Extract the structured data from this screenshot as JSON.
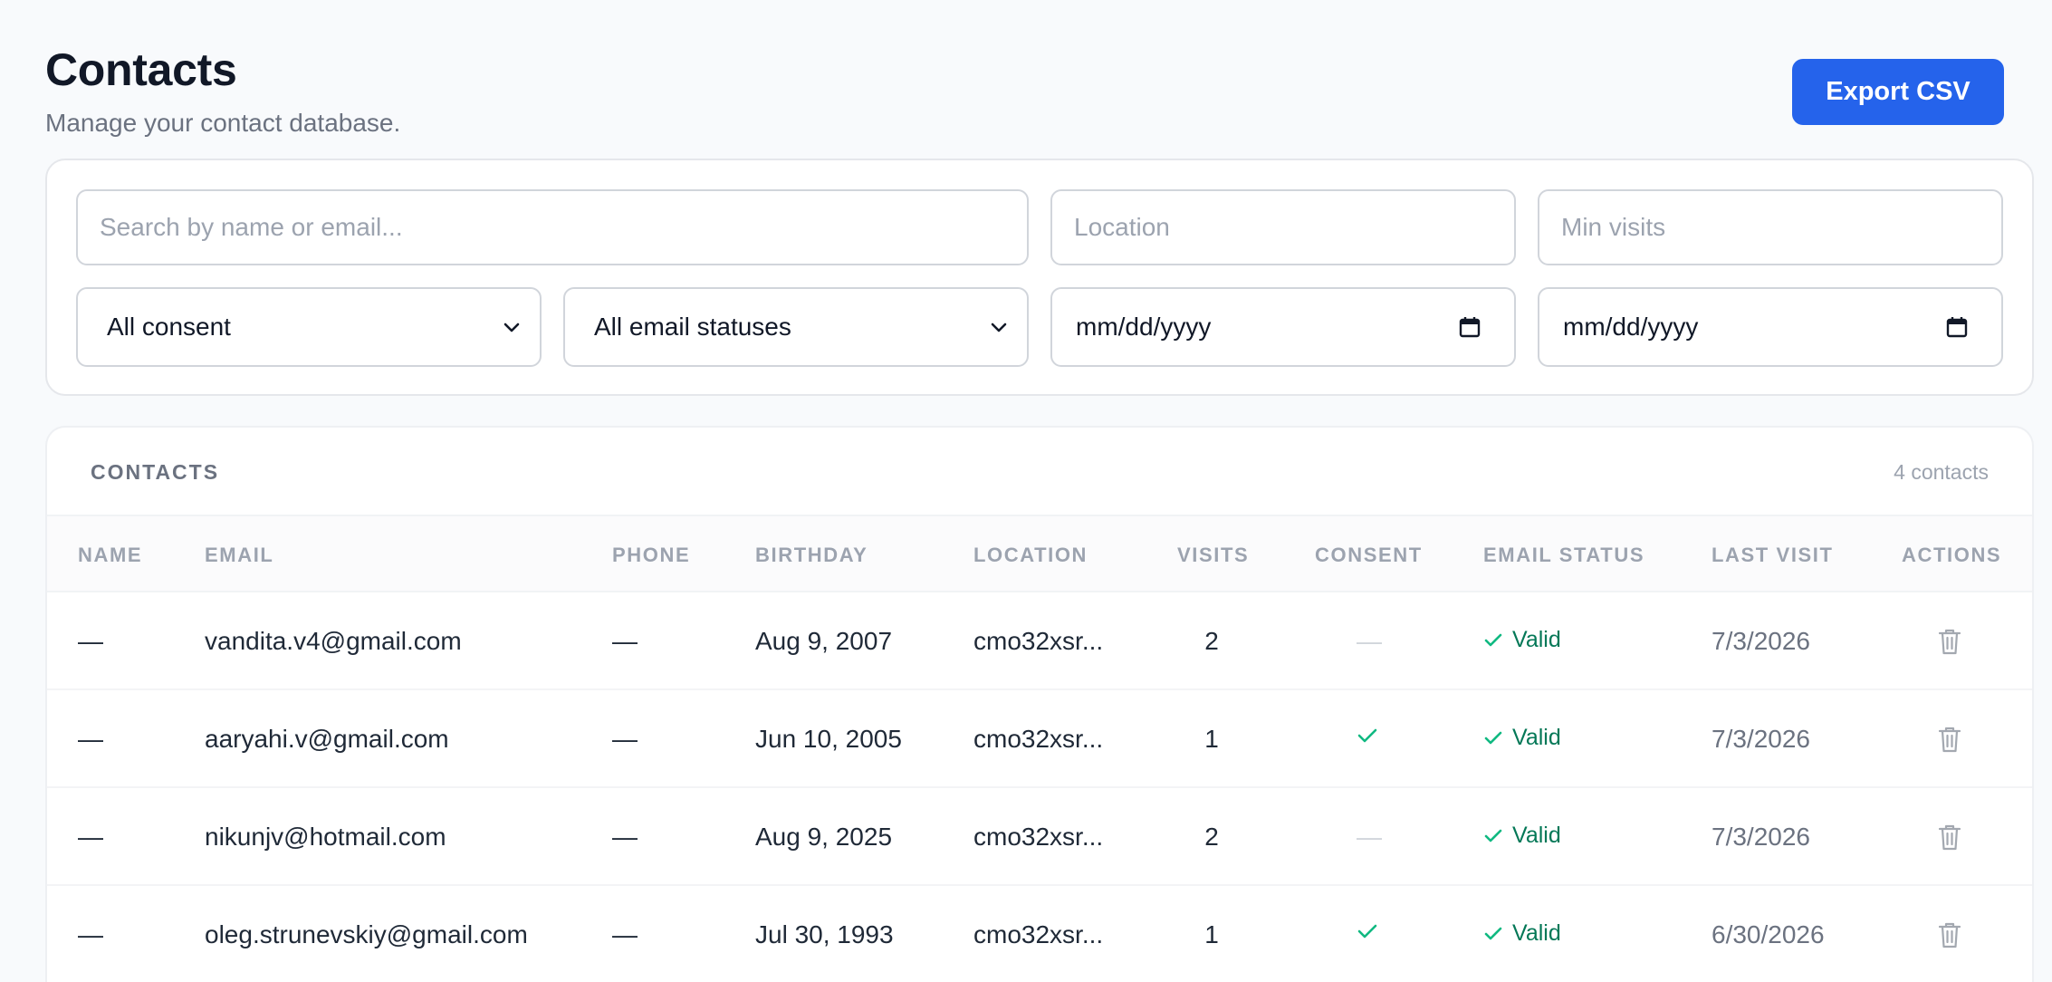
{
  "header": {
    "title": "Contacts",
    "subtitle": "Manage your contact database.",
    "export_label": "Export CSV"
  },
  "filters": {
    "search_placeholder": "Search by name or email...",
    "location_placeholder": "Location",
    "min_visits_placeholder": "Min visits",
    "consent_selected": "All consent",
    "email_status_selected": "All email statuses",
    "date_from_placeholder": "mm/dd/yyyy",
    "date_to_placeholder": "mm/dd/yyyy"
  },
  "table": {
    "title": "CONTACTS",
    "count": "4 contacts",
    "columns": {
      "name": "NAME",
      "email": "EMAIL",
      "phone": "PHONE",
      "birthday": "BIRTHDAY",
      "location": "LOCATION",
      "visits": "VISITS",
      "consent": "CONSENT",
      "email_status": "EMAIL STATUS",
      "last_visit": "LAST VISIT",
      "actions": "ACTIONS"
    },
    "rows": [
      {
        "name": "—",
        "email": "vandita.v4@gmail.com",
        "phone": "—",
        "birthday": "Aug 9, 2007",
        "location": "cmo32xsr...",
        "visits": "2",
        "consent": "—",
        "email_status": "Valid",
        "last_visit": "7/3/2026"
      },
      {
        "name": "—",
        "email": "aaryahi.v@gmail.com",
        "phone": "—",
        "birthday": "Jun 10, 2005",
        "location": "cmo32xsr...",
        "visits": "1",
        "consent": "check",
        "email_status": "Valid",
        "last_visit": "7/3/2026"
      },
      {
        "name": "—",
        "email": "nikunjv@hotmail.com",
        "phone": "—",
        "birthday": "Aug 9, 2025",
        "location": "cmo32xsr...",
        "visits": "2",
        "consent": "—",
        "email_status": "Valid",
        "last_visit": "7/3/2026"
      },
      {
        "name": "—",
        "email": "oleg.strunevskiy@gmail.com",
        "phone": "—",
        "birthday": "Jul 30, 1993",
        "location": "cmo32xsr...",
        "visits": "1",
        "consent": "check",
        "email_status": "Valid",
        "last_visit": "6/30/2026"
      }
    ]
  },
  "icons": {
    "select": "chevron-down-icon",
    "date": "calendar-icon",
    "valid": "check-icon",
    "delete": "trash-icon"
  },
  "colors": {
    "accent": "#2563eb",
    "valid": "#047857",
    "consent_check": "#10b981"
  }
}
